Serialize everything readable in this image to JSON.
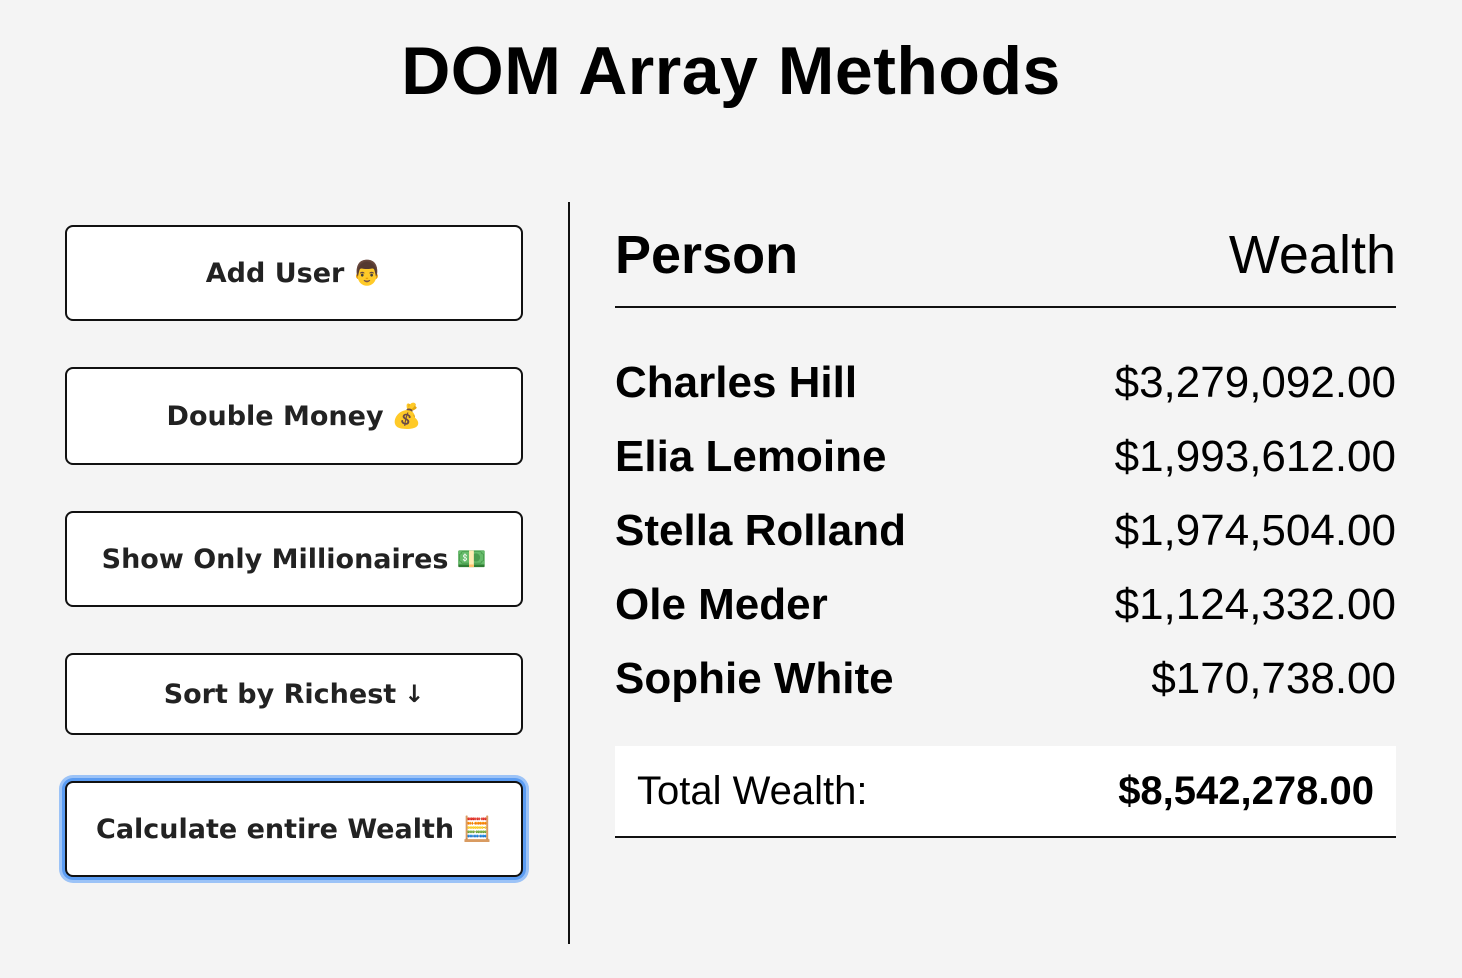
{
  "page": {
    "title": "DOM Array Methods"
  },
  "controls": {
    "add_user": {
      "label": "Add User",
      "emoji": "👨"
    },
    "double_money": {
      "label": "Double Money",
      "emoji": "💰"
    },
    "show_millionaires": {
      "label": "Show Only Millionaires",
      "emoji": "💵"
    },
    "sort_richest": {
      "label": "Sort by Richest",
      "emoji": "↓"
    },
    "calculate_wealth": {
      "label": "Calculate entire Wealth",
      "emoji": "🧮"
    }
  },
  "table": {
    "headers": {
      "person": "Person",
      "wealth": "Wealth"
    },
    "rows": [
      {
        "name": "Charles Hill",
        "money": "$3,279,092.00"
      },
      {
        "name": "Elia Lemoine",
        "money": "$1,993,612.00"
      },
      {
        "name": "Stella Rolland",
        "money": "$1,974,504.00"
      },
      {
        "name": "Ole Meder",
        "money": "$1,124,332.00"
      },
      {
        "name": "Sophie White",
        "money": "$170,738.00"
      }
    ],
    "total": {
      "label": "Total Wealth:",
      "value": "$8,542,278.00"
    }
  },
  "colors": {
    "background": "#f4f4f4",
    "button_bg": "#ffffff",
    "border": "#111111",
    "focus_ring": "#5b9cf2"
  }
}
